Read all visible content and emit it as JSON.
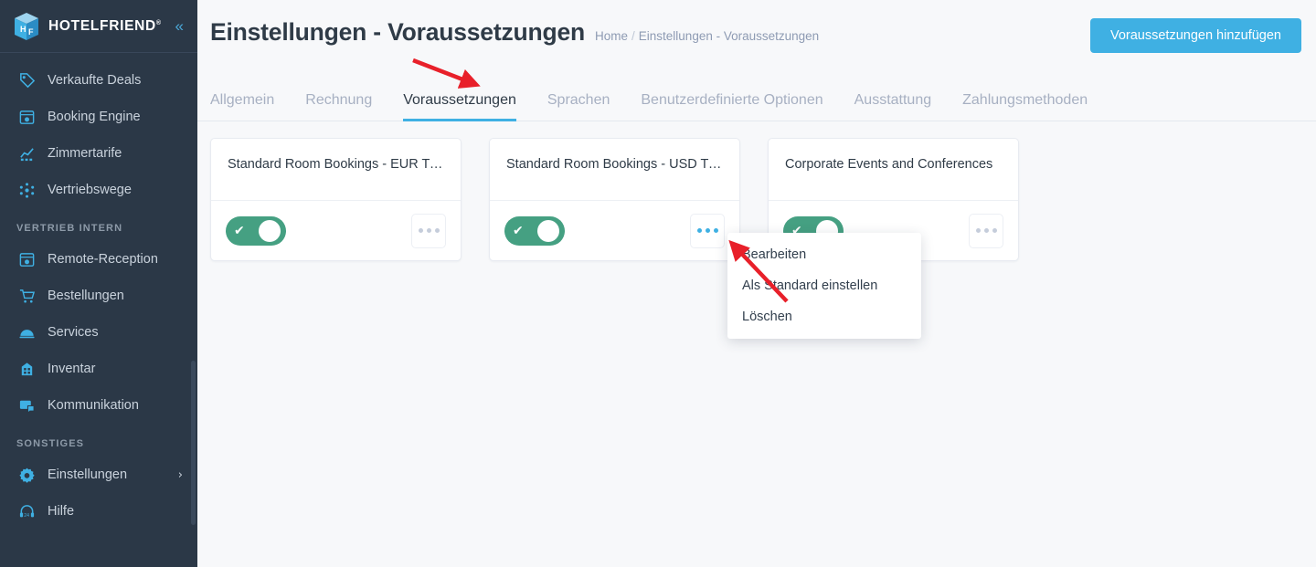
{
  "sidebar": {
    "brand": {
      "name": "HOTELFRIEND",
      "trademark": "®",
      "collapse_icon": "chevron-double-left-icon"
    },
    "groups": [
      {
        "label": null,
        "items": [
          {
            "label": "Verkaufte Deals",
            "icon": "tag-icon"
          },
          {
            "label": "Booking Engine",
            "icon": "browser-gear-icon"
          },
          {
            "label": "Zimmertarife",
            "icon": "chart-line-icon"
          },
          {
            "label": "Vertriebswege",
            "icon": "network-nodes-icon"
          }
        ]
      },
      {
        "label": "VERTRIEB INTERN",
        "items": [
          {
            "label": "Remote-Reception",
            "icon": "browser-gear-icon"
          },
          {
            "label": "Bestellungen",
            "icon": "shopping-cart-icon"
          },
          {
            "label": "Services",
            "icon": "room-service-bell-icon"
          },
          {
            "label": "Inventar",
            "icon": "building-icon"
          },
          {
            "label": "Kommunikation",
            "icon": "chat-bubble-icon"
          }
        ]
      },
      {
        "label": "SONSTIGES",
        "items": [
          {
            "label": "Einstellungen",
            "icon": "gear-icon",
            "chevron": "›"
          },
          {
            "label": "Hilfe",
            "icon": "headset-24-icon"
          }
        ]
      }
    ]
  },
  "header": {
    "title": "Einstellungen - Voraussetzungen",
    "breadcrumb": {
      "home": "Home",
      "separator": "/",
      "current": "Einstellungen - Voraussetzungen"
    },
    "add_button": "Voraussetzungen hinzufügen"
  },
  "tabs": [
    {
      "label": "Allgemein",
      "active": false
    },
    {
      "label": "Rechnung",
      "active": false
    },
    {
      "label": "Voraussetzungen",
      "active": true
    },
    {
      "label": "Sprachen",
      "active": false
    },
    {
      "label": "Benutzerdefinierte Optionen",
      "active": false
    },
    {
      "label": "Ausstattung",
      "active": false
    },
    {
      "label": "Zahlungsmethoden",
      "active": false
    }
  ],
  "cards": [
    {
      "title": "Standard Room Bookings - EUR Tran…",
      "enabled": true,
      "menu_open": false
    },
    {
      "title": "Standard Room Bookings - USD Tran…",
      "enabled": true,
      "menu_open": true
    },
    {
      "title": "Corporate Events and Conferences",
      "enabled": true,
      "menu_open": false
    }
  ],
  "dropdown": {
    "items": [
      "Bearbeiten",
      "Als Standard einstellen",
      "Löschen"
    ]
  },
  "annotations": [
    {
      "name": "arrow-to-voraussetzungen-tab",
      "color": "#e8202a"
    },
    {
      "name": "arrow-to-card-menu-button",
      "color": "#e8202a"
    }
  ],
  "colors": {
    "accent_blue": "#3fb0e3",
    "sidebar_bg": "#2b3847",
    "toggle_green": "#45a082",
    "annotation_red": "#e8202a"
  }
}
